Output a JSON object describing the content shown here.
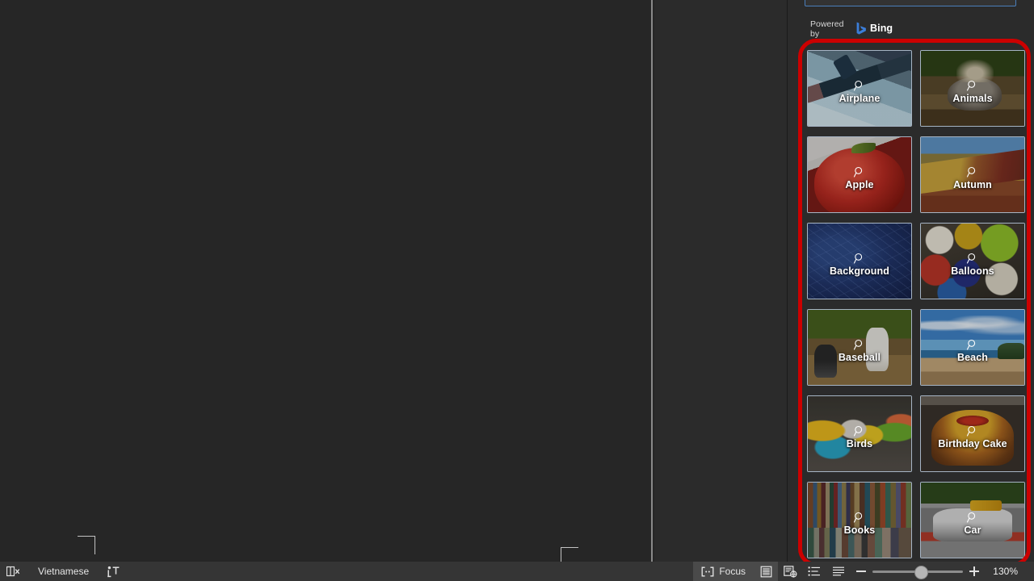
{
  "document": {
    "page_area_label": "document-page",
    "margin_marks": 2
  },
  "task_pane": {
    "search": {
      "value": "",
      "placeholder": ""
    },
    "powered_by_label": "Powered by",
    "provider_name": "Bing",
    "provider_icon": "bing-logo-icon"
  },
  "image_grid": {
    "magnifier_icon": "magnifier-icon",
    "tiles": [
      {
        "label": "Airplane",
        "art": "t-airplane"
      },
      {
        "label": "Animals",
        "art": "t-animals"
      },
      {
        "label": "Apple",
        "art": "t-apple"
      },
      {
        "label": "Autumn",
        "art": "t-autumn"
      },
      {
        "label": "Background",
        "art": "t-background"
      },
      {
        "label": "Balloons",
        "art": "t-balloons"
      },
      {
        "label": "Baseball",
        "art": "t-baseball"
      },
      {
        "label": "Beach",
        "art": "t-beach"
      },
      {
        "label": "Birds",
        "art": "t-birds"
      },
      {
        "label": "Birthday Cake",
        "art": "t-cake"
      },
      {
        "label": "Books",
        "art": "t-books"
      },
      {
        "label": "Car",
        "art": "t-car"
      }
    ]
  },
  "annotation": {
    "shape": "rounded-rectangle",
    "color": "#cc0000"
  },
  "status_bar": {
    "left": {
      "proofing_icon": "proofing-errors-icon",
      "language": "Vietnamese",
      "accessibility_icon": "accessibility-checker-icon"
    },
    "right": {
      "focus_label": "Focus",
      "focus_icon": "focus-mode-icon",
      "read_mode_icon": "read-mode-icon",
      "web_layout_icon": "web-layout-icon",
      "outline_view_icon": "outline-view-icon",
      "draft_view_icon": "draft-view-icon",
      "zoom_out_icon": "zoom-out-icon",
      "zoom_in_icon": "zoom-in-icon",
      "zoom_level": "130%",
      "zoom_slider_position_percent": 55
    }
  },
  "colors": {
    "app_background": "#262626",
    "pane_background": "#2b2b2b",
    "status_bar_background": "#353535",
    "accent_blue": "#4a7ebb",
    "annotation_red": "#cc0000",
    "bing_blue": "#3b7dd8"
  }
}
